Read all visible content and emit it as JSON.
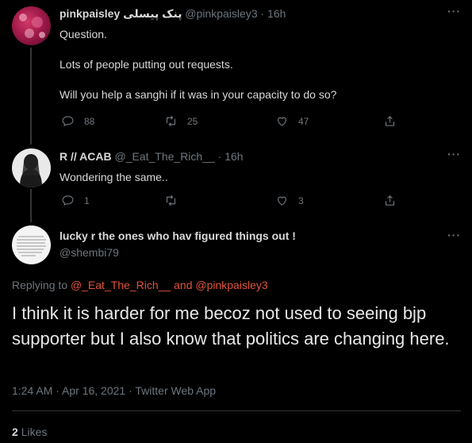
{
  "tweets": [
    {
      "display_name": "pinkpaisley پنک پیسلی",
      "handle": "@pinkpaisley3",
      "time": "· 16h",
      "lines": [
        "Question.",
        "Lots of people putting out requests.",
        "Will you help a sanghi if it was in your capacity to do so?"
      ],
      "replies": "88",
      "retweets": "25",
      "likes": "47"
    },
    {
      "display_name": "R // ACAB",
      "handle": "@_Eat_The_Rich__",
      "time": "· 16h",
      "lines": [
        "Wondering the same.."
      ],
      "replies": "1",
      "retweets": "",
      "likes": "3"
    }
  ],
  "main_tweet": {
    "display_name": "lucky r the ones who hav figured things out !",
    "handle": "@shembi79",
    "replying_prefix": "Replying to",
    "replying_user1": "@_Eat_The_Rich__",
    "replying_and": "and",
    "replying_user2": "@pinkpaisley3",
    "text": "I think it is harder for me becoz not used to seeing bjp supporter but I also know that politics are changing here.",
    "timestamp": "1:24 AM · Apr 16, 2021 · Twitter Web App",
    "likes_count": "2",
    "likes_label": "Likes"
  },
  "more_label": "···",
  "colors": {
    "background": "#000000",
    "link": "#e0533a",
    "muted": "#6e767d",
    "text": "#d9d9d9"
  },
  "icons": [
    "reply-icon",
    "retweet-icon",
    "like-icon",
    "share-icon",
    "more-icon"
  ]
}
